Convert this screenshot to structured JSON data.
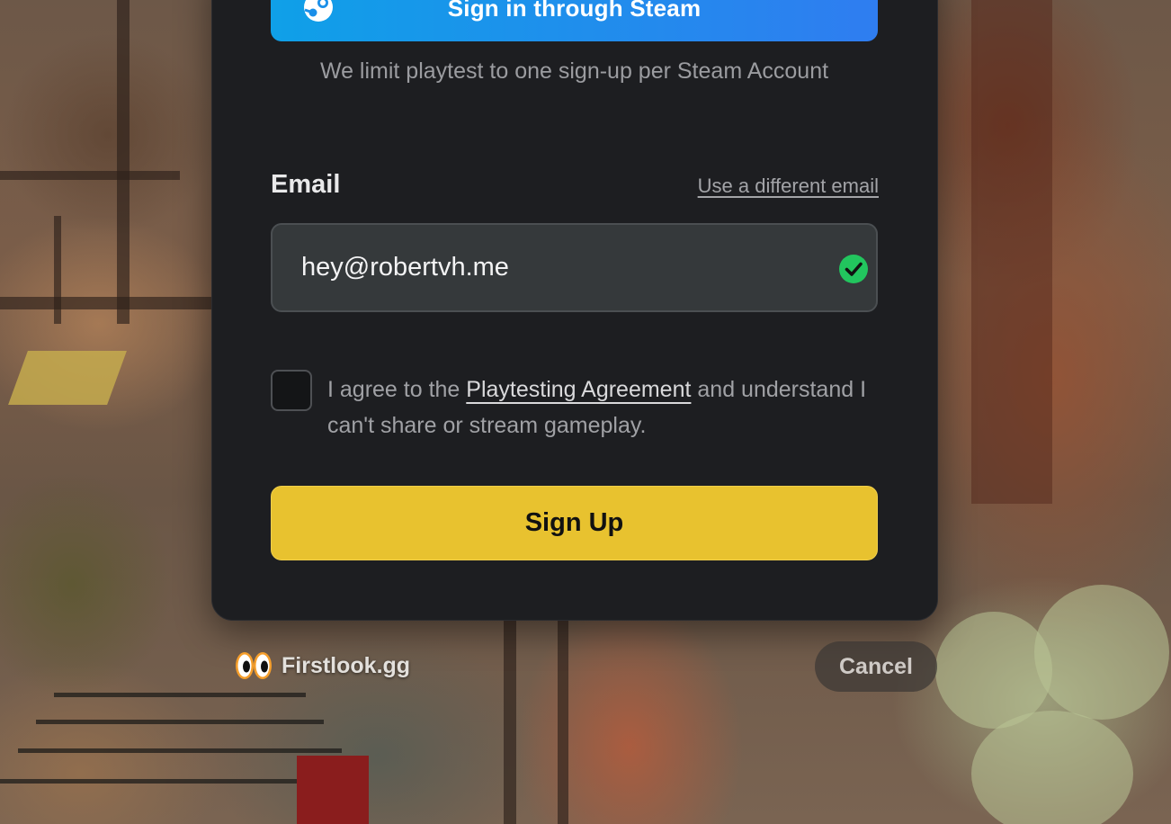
{
  "steam_signin": {
    "label": "Sign in through Steam",
    "icon": "steam-icon",
    "color_start": "#0fa0e8",
    "color_end": "#2f7df0"
  },
  "limit_note": "We limit playtest to one sign-up per Steam Account",
  "email": {
    "label": "Email",
    "alt_link": "Use a different email",
    "value": "hey@robertvh.me",
    "status_icon": "check-circle-icon",
    "status_color": "#22c55e"
  },
  "agreement": {
    "checked": false,
    "text_before": "I agree to the ",
    "link": "Playtesting Agreement",
    "text_after": " and understand I can't share or stream gameplay."
  },
  "signup": {
    "label": "Sign Up",
    "color": "#e8c22f"
  },
  "footer": {
    "brand_icon": "eyes-icon",
    "brand_name": "Firstlook.gg",
    "cancel_label": "Cancel"
  }
}
